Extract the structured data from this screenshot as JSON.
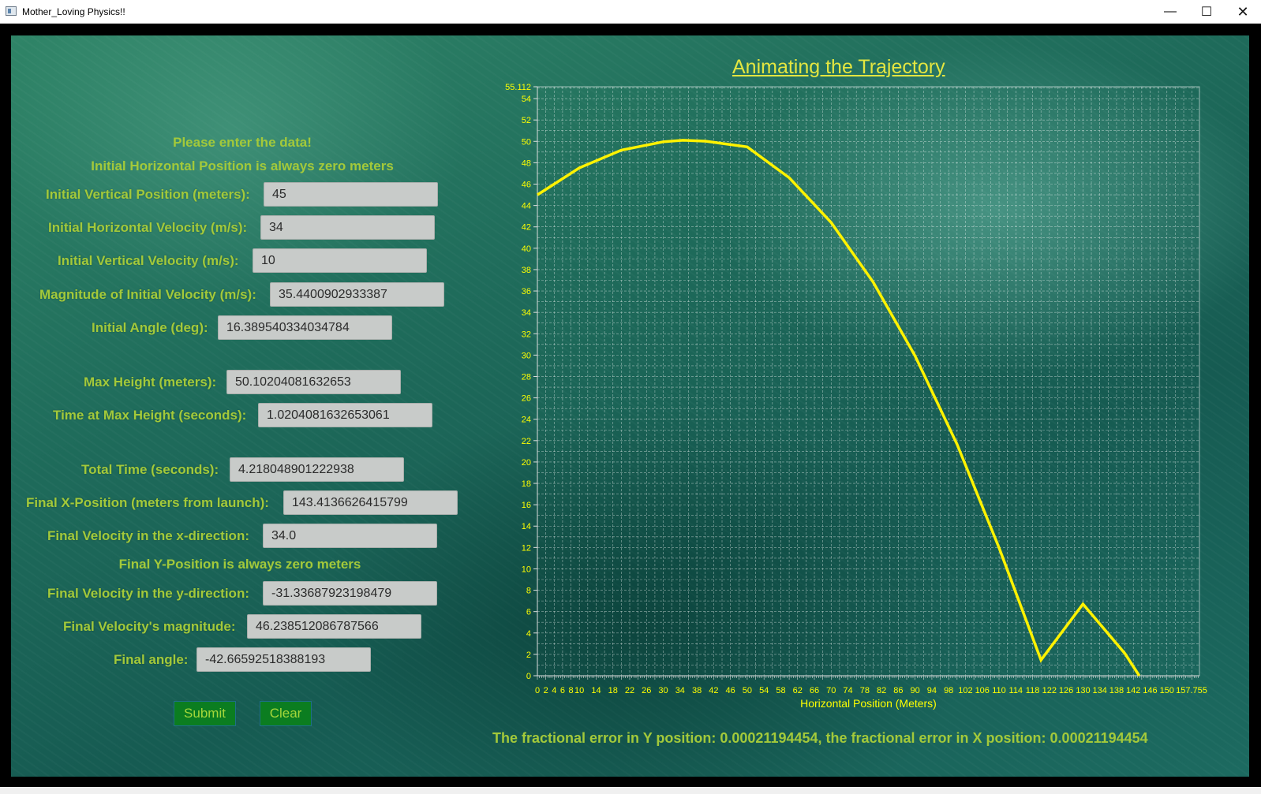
{
  "window": {
    "title": "Mother_Loving Physics!!",
    "minimize_glyph": "—",
    "maximize_glyph": "☐",
    "close_glyph": "✕"
  },
  "form": {
    "heading": "Please enter the data!",
    "note_horizontal": "Initial Horizontal Position is always zero meters",
    "note_final_y": "Final Y-Position is always zero meters",
    "fields": {
      "initial_vertical_position": {
        "label": "Initial Vertical Position (meters):",
        "value": "45"
      },
      "initial_horizontal_velocity": {
        "label": "Initial Horizontal Velocity (m/s):",
        "value": "34"
      },
      "initial_vertical_velocity": {
        "label": "Initial Vertical Velocity (m/s):",
        "value": "10"
      },
      "initial_velocity_magnitude": {
        "label": "Magnitude of Initial Velocity (m/s):",
        "value": "35.4400902933387"
      },
      "initial_angle": {
        "label": "Initial Angle (deg):",
        "value": "16.389540334034784"
      },
      "max_height": {
        "label": "Max Height (meters):",
        "value": "50.10204081632653"
      },
      "time_at_max_height": {
        "label": "Time at Max Height (seconds):",
        "value": "1.0204081632653061"
      },
      "total_time": {
        "label": "Total Time (seconds):",
        "value": "4.218048901222938"
      },
      "final_x_position": {
        "label": "Final X-Position (meters from launch):",
        "value": "143.4136626415799"
      },
      "final_velocity_x": {
        "label": "Final Velocity in the x-direction:",
        "value": "34.0"
      },
      "final_velocity_y": {
        "label": "Final Velocity in the y-direction:",
        "value": "-31.33687923198479"
      },
      "final_velocity_magnitude": {
        "label": "Final Velocity's magnitude:",
        "value": "46.238512086787566"
      },
      "final_angle": {
        "label": "Final angle:",
        "value": "-42.66592518388193"
      }
    },
    "submit_label": "Submit",
    "clear_label": "Clear"
  },
  "error_text": "The fractional error in Y position: 0.00021194454, the fractional error in X position: 0.00021194454",
  "colors": {
    "label": "#a3c93a",
    "curve": "#fff200",
    "title": "#e4e640",
    "tick": "#ffff00",
    "grid": "#ffffff"
  },
  "chart_data": {
    "type": "line",
    "title": "Animating the Trajectory",
    "xlabel": "Horizontal Position (Meters)",
    "ylabel": "",
    "xlim": [
      0,
      157.755
    ],
    "ylim": [
      0,
      55.112
    ],
    "x_ticks": [
      0,
      2,
      4,
      6,
      8,
      10,
      14,
      18,
      22,
      26,
      30,
      34,
      38,
      42,
      46,
      50,
      54,
      58,
      62,
      66,
      70,
      74,
      78,
      82,
      86,
      90,
      94,
      98,
      102,
      106,
      110,
      114,
      118,
      122,
      126,
      130,
      134,
      138,
      142,
      146,
      150,
      157.755
    ],
    "x_tick_labels": [
      "0",
      "2",
      "4",
      "6",
      "8",
      "10",
      "14",
      "18",
      "22",
      "26",
      "30",
      "34",
      "38",
      "42",
      "46",
      "50",
      "54",
      "58",
      "62",
      "66",
      "70",
      "74",
      "78",
      "82",
      "86",
      "90",
      "94",
      "98",
      "102",
      "106",
      "110",
      "114",
      "118",
      "122",
      "126",
      "130",
      "134",
      "138",
      "142",
      "146",
      "150",
      "157.755"
    ],
    "y_ticks": [
      0,
      2,
      4,
      6,
      8,
      10,
      12,
      14,
      16,
      18,
      20,
      22,
      24,
      26,
      28,
      30,
      32,
      34,
      36,
      38,
      40,
      42,
      44,
      46,
      48,
      50,
      52,
      54,
      55.112
    ],
    "y_tick_labels": [
      "0",
      "2",
      "4",
      "6",
      "8",
      "10",
      "12",
      "14",
      "16",
      "18",
      "20",
      "22",
      "24",
      "26",
      "28",
      "30",
      "32",
      "34",
      "36",
      "38",
      "40",
      "42",
      "44",
      "46",
      "48",
      "50",
      "52",
      "54",
      "55.112"
    ],
    "grid": true,
    "legend": "none",
    "series": [
      {
        "x": [
          0,
          10,
          20,
          30,
          34.69,
          40,
          50,
          60,
          70,
          80,
          90,
          100,
          110,
          120,
          130,
          140,
          143.41
        ],
        "y": [
          45,
          47.52,
          49.18,
          49.96,
          50.1,
          50.02,
          49.48,
          46.6,
          42.41,
          36.83,
          29.92,
          21.66,
          11.98,
          1.47,
          6.71,
          2.07,
          0
        ]
      }
    ]
  }
}
